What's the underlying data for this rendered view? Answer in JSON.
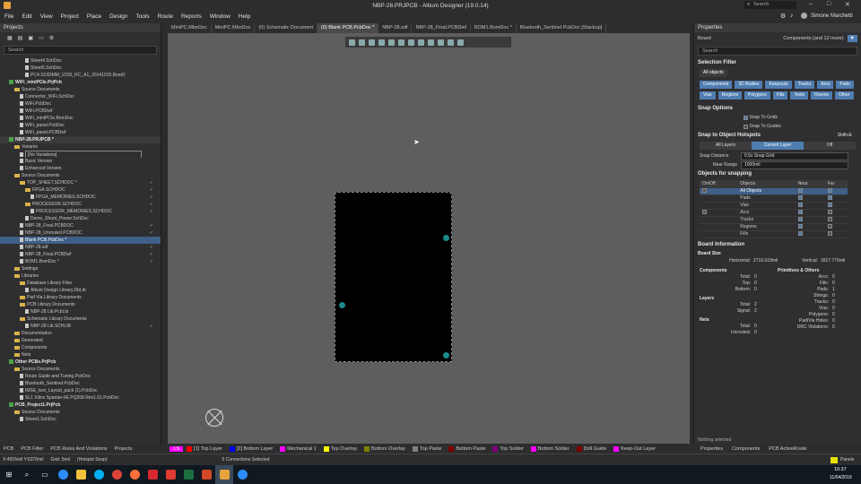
{
  "title": "NBP-28.PRJPCB - Altium Designer (19.0.14)",
  "search_label": "Search",
  "user": "Simone Marchetti",
  "menu": [
    "File",
    "Edit",
    "View",
    "Project",
    "Place",
    "Design",
    "Tools",
    "Route",
    "Reports",
    "Window",
    "Help"
  ],
  "projects_panel": {
    "title": "Projects",
    "search_placeholder": "Search",
    "tree": [
      {
        "t": "Sheet4.SchDoc",
        "i": "doc",
        "l": 4
      },
      {
        "t": "Sheet5.SchDoc",
        "i": "doc",
        "l": 4
      },
      {
        "t": "PC4-SODIMM_V200_RC_A1_20141015.BomD",
        "i": "doc",
        "l": 4
      },
      {
        "t": "WiFi_miniPCIe.PrjPcb",
        "i": "prj",
        "l": 1,
        "b": true
      },
      {
        "t": "Source Documents",
        "i": "fld",
        "l": 2
      },
      {
        "t": "Connector_WiFi.SchDoc",
        "i": "doc",
        "l": 3
      },
      {
        "t": "WiFi.PcbDoc",
        "i": "doc",
        "l": 3
      },
      {
        "t": "WiFi.PCBDwf",
        "i": "doc",
        "l": 3
      },
      {
        "t": "WiFi_miniPCIe.BomDoc",
        "i": "doc",
        "l": 3
      },
      {
        "t": "WiFi_panel.PcbDoc",
        "i": "doc",
        "l": 3
      },
      {
        "t": "WiFi_panel.PCBDwf",
        "i": "doc",
        "l": 3
      },
      {
        "t": "NBP-28.PRJPCB *",
        "i": "prj",
        "l": 1,
        "b": true,
        "hl": true
      },
      {
        "t": "Variants",
        "i": "fld",
        "l": 2
      },
      {
        "t": "[No Variations]",
        "i": "doc",
        "l": 3,
        "box": true
      },
      {
        "t": "Basic Version",
        "i": "doc",
        "l": 3
      },
      {
        "t": "Enhanced Version",
        "i": "doc",
        "l": 3
      },
      {
        "t": "Source Documents",
        "i": "fld",
        "l": 2
      },
      {
        "t": "TOP_SHEET.SCHDOC *",
        "i": "fld",
        "l": 3,
        "s": "✓"
      },
      {
        "t": "FPGA.SCHDOC",
        "i": "fld",
        "l": 4,
        "s": "✓"
      },
      {
        "t": "FPGA_MEMORIES.SCHDOC",
        "i": "doc",
        "l": 5,
        "s": "✓"
      },
      {
        "t": "PROCESSOR.SCHDOC",
        "i": "fld",
        "l": 4,
        "s": "✓"
      },
      {
        "t": "PROCESSOR_MEMORIES.SCHDOC",
        "i": "doc",
        "l": 5,
        "s": "✓"
      },
      {
        "t": "Demo_Shunt_Power.SchDoc",
        "i": "doc",
        "l": 4
      },
      {
        "t": "NBP-28_Final.PCBDOC",
        "i": "doc",
        "l": 3,
        "s": "✓"
      },
      {
        "t": "NBP-28_Unrouted.PCBDOC",
        "i": "doc",
        "l": 3,
        "s": "✓"
      },
      {
        "t": "Blank PCB.PcbDoc *",
        "i": "doc",
        "l": 3,
        "sel": true
      },
      {
        "t": "NBP-28.sdf",
        "i": "doc",
        "l": 3,
        "s": "✓"
      },
      {
        "t": "NBP-28_Final.PCBDwf",
        "i": "doc",
        "l": 3,
        "s": "✓"
      },
      {
        "t": "BOM1.BomDoc *",
        "i": "doc",
        "l": 3,
        "s": "✓"
      },
      {
        "t": "Settings",
        "i": "fld",
        "l": 2
      },
      {
        "t": "Libraries",
        "i": "fld",
        "l": 2
      },
      {
        "t": "Database Library Files",
        "i": "fld",
        "l": 3
      },
      {
        "t": "Altium Design Library.DbLib",
        "i": "doc",
        "l": 4
      },
      {
        "t": "Pad Via Library Documents",
        "i": "fld",
        "l": 3
      },
      {
        "t": "PCB Library Documents",
        "i": "fld",
        "l": 3
      },
      {
        "t": "NBP-28 Lib.PcbLib",
        "i": "doc",
        "l": 4
      },
      {
        "t": "Schematic Library Documents",
        "i": "fld",
        "l": 3
      },
      {
        "t": "NBP-28 Lib.SCHLIB",
        "i": "doc",
        "l": 4,
        "s": "✓"
      },
      {
        "t": "Documentation",
        "i": "fld",
        "l": 2
      },
      {
        "t": "Generated",
        "i": "fld",
        "l": 2
      },
      {
        "t": "Components",
        "i": "fld",
        "l": 2
      },
      {
        "t": "Nets",
        "i": "fld",
        "l": 2
      },
      {
        "t": "Other PCBs.PrjPcb",
        "i": "prj",
        "l": 1,
        "b": true
      },
      {
        "t": "Source Documents",
        "i": "fld",
        "l": 2
      },
      {
        "t": "Route Guide and Tuning.PcbDoc",
        "i": "doc",
        "l": 3
      },
      {
        "t": "Bluetooth_Sentinel.PcbDoc",
        "i": "doc",
        "l": 3
      },
      {
        "t": "IMSE_test_Layout_pack (1).PcbDoc",
        "i": "doc",
        "l": 3
      },
      {
        "t": "SL1 Xilinx Spartan-IIE PQ208 Rev1.01.PcbDoc",
        "i": "doc",
        "l": 3
      },
      {
        "t": "PCB_Project1.PrjPcb",
        "i": "prj",
        "l": 1,
        "b": true
      },
      {
        "t": "Source Documents",
        "i": "fld",
        "l": 2
      },
      {
        "t": "Sheet1.SchDoc",
        "i": "doc",
        "l": 3
      }
    ]
  },
  "doc_tabs": [
    {
      "label": "MiniPC.MboDoc",
      "active": false
    },
    {
      "label": "MiniPC.MboDoc",
      "active": false
    },
    {
      "label": "(0) Schematic Document",
      "active": false
    },
    {
      "label": "(0) Blank PCB.PcbDoc *",
      "active": true
    },
    {
      "label": "NBP-28.sdf",
      "active": false
    },
    {
      "label": "NBP-28_Final.PCBDwf",
      "active": false
    },
    {
      "label": "BOM1.BomDoc *",
      "active": false
    },
    {
      "label": "Bluetooth_Sentinel.PcbDoc [Stackup]",
      "active": false
    }
  ],
  "properties": {
    "title": "Properties",
    "object": "Board",
    "scope": "Components (and 12 more)",
    "search_placeholder": "Search",
    "selection_filter_title": "Selection Filter",
    "all_objects": "All objects",
    "filter_chips": [
      "Components",
      "3D Bodies",
      "Keepouts",
      "Tracks",
      "Arcs",
      "Pads",
      "Vias",
      "Regions",
      "Polygons",
      "Fills",
      "Texts",
      "Rooms",
      "Other"
    ],
    "snap_options_title": "Snap Options",
    "snap_to_grids": "Snap To Grids",
    "snap_to_guides": "Snap To Guides",
    "hotspots_title": "Snap to Object Hotspots",
    "hotspots_shortcut": "Shift+E",
    "layer_opts": [
      "All Layers",
      "Current Layer",
      "Off"
    ],
    "snap_distance_label": "Snap Distance",
    "snap_distance_value": "0.5x Snap Grid",
    "near_range_label": "Near Range",
    "near_range_value": "1000mil",
    "objects_for_snapping": "Objects for snapping",
    "snap_headers": [
      "On/Off",
      "Objects",
      "Near",
      "Far"
    ],
    "snap_rows": [
      "All Objects",
      "Pads",
      "Vias",
      "Arcs",
      "Tracks",
      "Regions",
      "Fills"
    ],
    "board_info_title": "Board Information",
    "board_size": "Board Size",
    "horizontal_label": "Horizontal:",
    "horizontal_value": "2716.618mil",
    "vertical_label": "Vertical:",
    "vertical_value": "3917.776mil",
    "components_title": "Components",
    "primitives_title": "Primitives & Others",
    "comp_kv": [
      [
        "Total:",
        "0"
      ],
      [
        "Top:",
        "0"
      ],
      [
        "Bottom:",
        "0"
      ]
    ],
    "prim_kv": [
      [
        "Arcs:",
        "0"
      ],
      [
        "Fills:",
        "0"
      ],
      [
        "Pads:",
        "1"
      ],
      [
        "Strings:",
        "0"
      ],
      [
        "Tracks:",
        "0"
      ],
      [
        "Vias:",
        "0"
      ],
      [
        "Polygons:",
        "0"
      ],
      [
        "Pad/Via Holes:",
        "0"
      ],
      [
        "DRC Violations:",
        "0"
      ]
    ],
    "layers_title": "Layers",
    "layers_kv": [
      [
        "Total:",
        "2"
      ],
      [
        "Signal:",
        "2"
      ]
    ],
    "nets_title": "Nets",
    "nets_kv": [
      [
        "Total:",
        "0"
      ],
      [
        "Unrouted:",
        "0"
      ]
    ],
    "nothing_selected": "Nothing selected"
  },
  "bottom_tabs": [
    "PCB",
    "PCB Filter",
    "PCB Rules And Violations",
    "Projects"
  ],
  "layer_ls": "LS",
  "layers": [
    {
      "n": "[1] Top Layer",
      "c": "#ff0000"
    },
    {
      "n": "[2] Bottom Layer",
      "c": "#0000ff"
    },
    {
      "n": "Mechanical 1",
      "c": "#ff00ff"
    },
    {
      "n": "Top Overlay",
      "c": "#ffff00"
    },
    {
      "n": "Bottom Overlay",
      "c": "#808000"
    },
    {
      "n": "Top Paste",
      "c": "#808080"
    },
    {
      "n": "Bottom Paste",
      "c": "#800000"
    },
    {
      "n": "Top Solder",
      "c": "#800080"
    },
    {
      "n": "Bottom Solder",
      "c": "#ff00ff"
    },
    {
      "n": "Drill Guide",
      "c": "#800000"
    },
    {
      "n": "Keep-Out Layer",
      "c": "#ff00ff"
    }
  ],
  "right_tabs": [
    "Properties",
    "Components",
    "PCB ActiveRoute"
  ],
  "status": {
    "coords": "X:4555mil Y:6370mil",
    "grid": "Grid: 5mil",
    "snap": "(Hotspot Snap)",
    "connections": "0 Connections Selected",
    "panels": "Panels"
  },
  "clock": {
    "time": "10:37",
    "date": "11/04/2019"
  }
}
